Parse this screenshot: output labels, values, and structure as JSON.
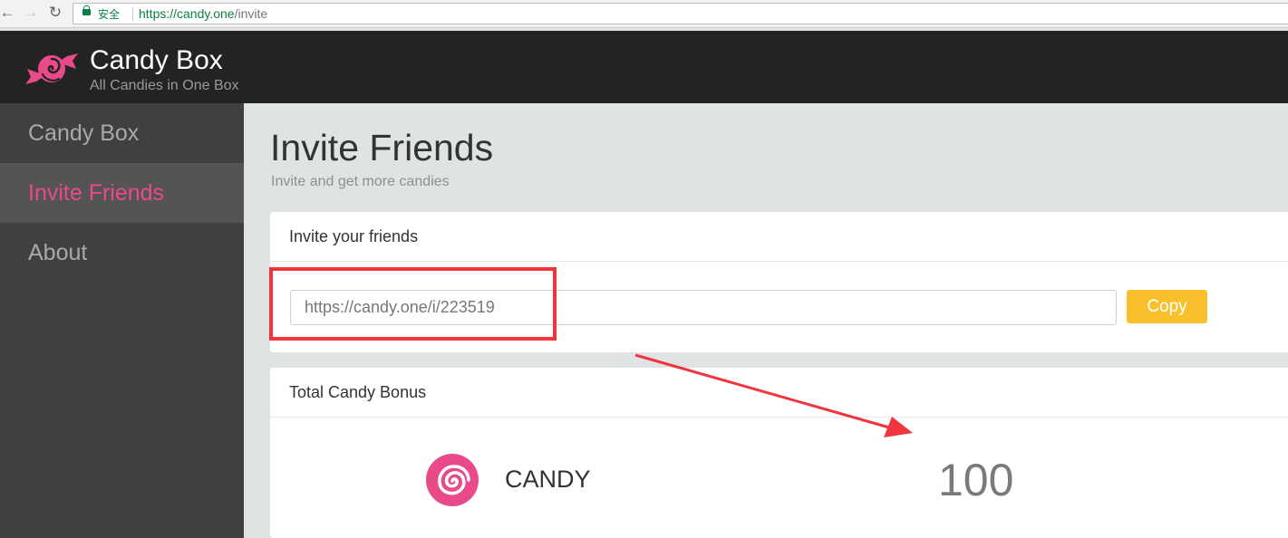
{
  "browser": {
    "secure_label": "安全",
    "url_host": "https://candy.one",
    "url_path": "/invite"
  },
  "header": {
    "title": "Candy Box",
    "subtitle": "All Candies in One Box",
    "logo_icon": "candy-icon"
  },
  "sidebar": {
    "items": [
      {
        "label": "Candy Box",
        "active": false
      },
      {
        "label": "Invite Friends",
        "active": true
      },
      {
        "label": "About",
        "active": false
      }
    ]
  },
  "page": {
    "title": "Invite Friends",
    "subtitle": "Invite and get more candies"
  },
  "invite_card": {
    "heading": "Invite your friends",
    "link_value": "https://candy.one/i/223519",
    "copy_label": "Copy"
  },
  "bonus_card": {
    "heading": "Total Candy Bonus",
    "token_name": "CANDY",
    "amount": "100",
    "token_icon": "spiral-candy-icon"
  },
  "colors": {
    "accent_pink": "#e94b8a",
    "copy_button": "#f8c12c",
    "annotation_red": "#f0353f",
    "header_bg": "#232323",
    "sidebar_bg": "#404040"
  }
}
